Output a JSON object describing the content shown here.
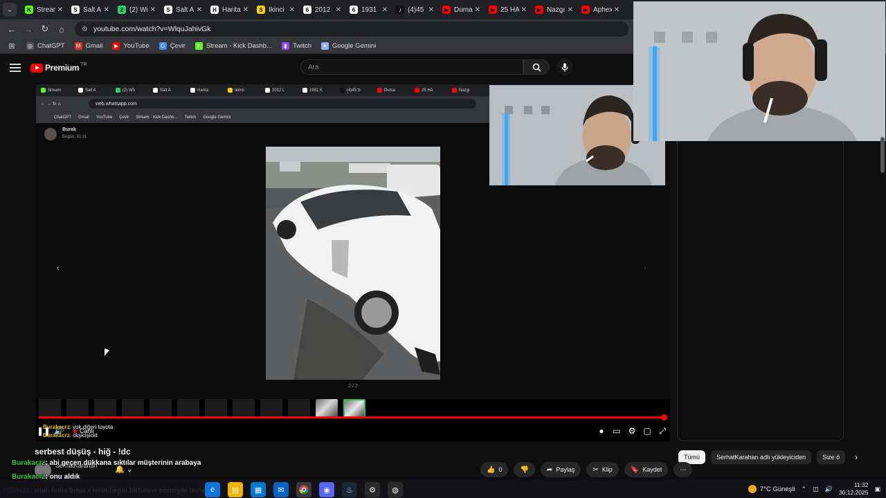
{
  "browser": {
    "tabs": [
      {
        "label": "Stream",
        "color": "#53fc18",
        "glyph": "K"
      },
      {
        "label": "Salt A",
        "color": "#ffffff",
        "glyph": "S"
      },
      {
        "label": "(2) Wi",
        "color": "#25d366",
        "glyph": "2"
      },
      {
        "label": "Salt A",
        "color": "#ffffff",
        "glyph": "S"
      },
      {
        "label": "Harita",
        "color": "#ffffff",
        "glyph": "H"
      },
      {
        "label": "İkinci",
        "color": "#ffd400",
        "glyph": "S"
      },
      {
        "label": "2012",
        "color": "#ffffff",
        "glyph": "6"
      },
      {
        "label": "1931",
        "color": "#ffffff",
        "glyph": "6"
      },
      {
        "label": "(4)45",
        "color": "#111111",
        "glyph": "♪"
      },
      {
        "label": "Duma",
        "color": "#ff0000",
        "glyph": "▶"
      },
      {
        "label": "25 HA",
        "color": "#ff0000",
        "glyph": "▶"
      },
      {
        "label": "Nazgı",
        "color": "#ff0000",
        "glyph": "▶"
      },
      {
        "label": "Aphex",
        "color": "#ff0000",
        "glyph": "▶"
      }
    ],
    "url": "youtube.com/watch?v=WlquJahivGk",
    "bookmarks": [
      {
        "label": "ChatGPT",
        "color": "#555555",
        "glyph": "◎"
      },
      {
        "label": "Gmail",
        "color": "#d93025",
        "glyph": "M"
      },
      {
        "label": "YouTube",
        "color": "#ff0000",
        "glyph": "▶"
      },
      {
        "label": "Çevir",
        "color": "#4285f4",
        "glyph": "G"
      },
      {
        "label": "Stream - Kick Dashb...",
        "color": "#53fc18",
        "glyph": "K"
      },
      {
        "label": "Twitch",
        "color": "#9146ff",
        "glyph": "▮"
      },
      {
        "label": "Google Gemini",
        "color": "#8ab4f8",
        "glyph": "✦"
      }
    ]
  },
  "youtube": {
    "logo": "Premium",
    "region": "TR",
    "search_placeholder": "Ara"
  },
  "player": {
    "inner_url": "web.whatsapp.com",
    "inner_tabs": [
      "Stream",
      "Salt A",
      "(2) Wh",
      "Salt A",
      "Harita",
      "İkinci",
      "2012 L",
      "1931 K",
      "(4)45 S",
      "Duma",
      "25 HA",
      "Nazgı"
    ],
    "inner_bookmarks": [
      "ChatGPT",
      "Gmail",
      "YouTube",
      "Çevir",
      "Stream - Kick Dashb...",
      "Twitch",
      "Google Gemini"
    ],
    "sender": "Burak",
    "sent_time": "Bugün, 11:31",
    "photo_counter": "2 / 2",
    "progress_fraction": 0.995,
    "live_label": "Canlı",
    "overlay_chat": [
      {
        "user": "Burakacrz",
        "msg": ": yok diğeri toyota"
      },
      {
        "user": "Burakacrz",
        "msg": ": ckşicişicid"
      }
    ]
  },
  "video": {
    "title": "serbest düşüş - hiğ - !dc",
    "channel": "SerhatKarahan",
    "actions": [
      {
        "icon": "like-icon",
        "label": "0"
      },
      {
        "icon": "dislike-icon",
        "label": ""
      },
      {
        "icon": "share-icon",
        "label": "Paylaş"
      },
      {
        "icon": "clip-icon",
        "label": "Klip"
      },
      {
        "icon": "save-icon",
        "label": "Kaydet"
      }
    ]
  },
  "chips": [
    "Tümü",
    "SerhatKarahan adlı yükleyiciden",
    "Size ö"
  ],
  "chat": [
    {
      "user": "Burakacrz",
      "msg": ": abi geçen dükkana sıktılar müşterinin arabaya",
      "color": "#2ecc40"
    },
    {
      "user": "Burakacrz",
      "msg": ": onu aldık",
      "color": "#2ecc40"
    },
    {
      "user": "HSVN36",
      "msg": ": allah halla bmw x lerin hepsi birbirine benziyor bune",
      "color": "#3c8cff"
    }
  ],
  "taskbar": {
    "weather": "7°C  Güneşli",
    "time": "11:32",
    "date": "30.12.2025"
  }
}
